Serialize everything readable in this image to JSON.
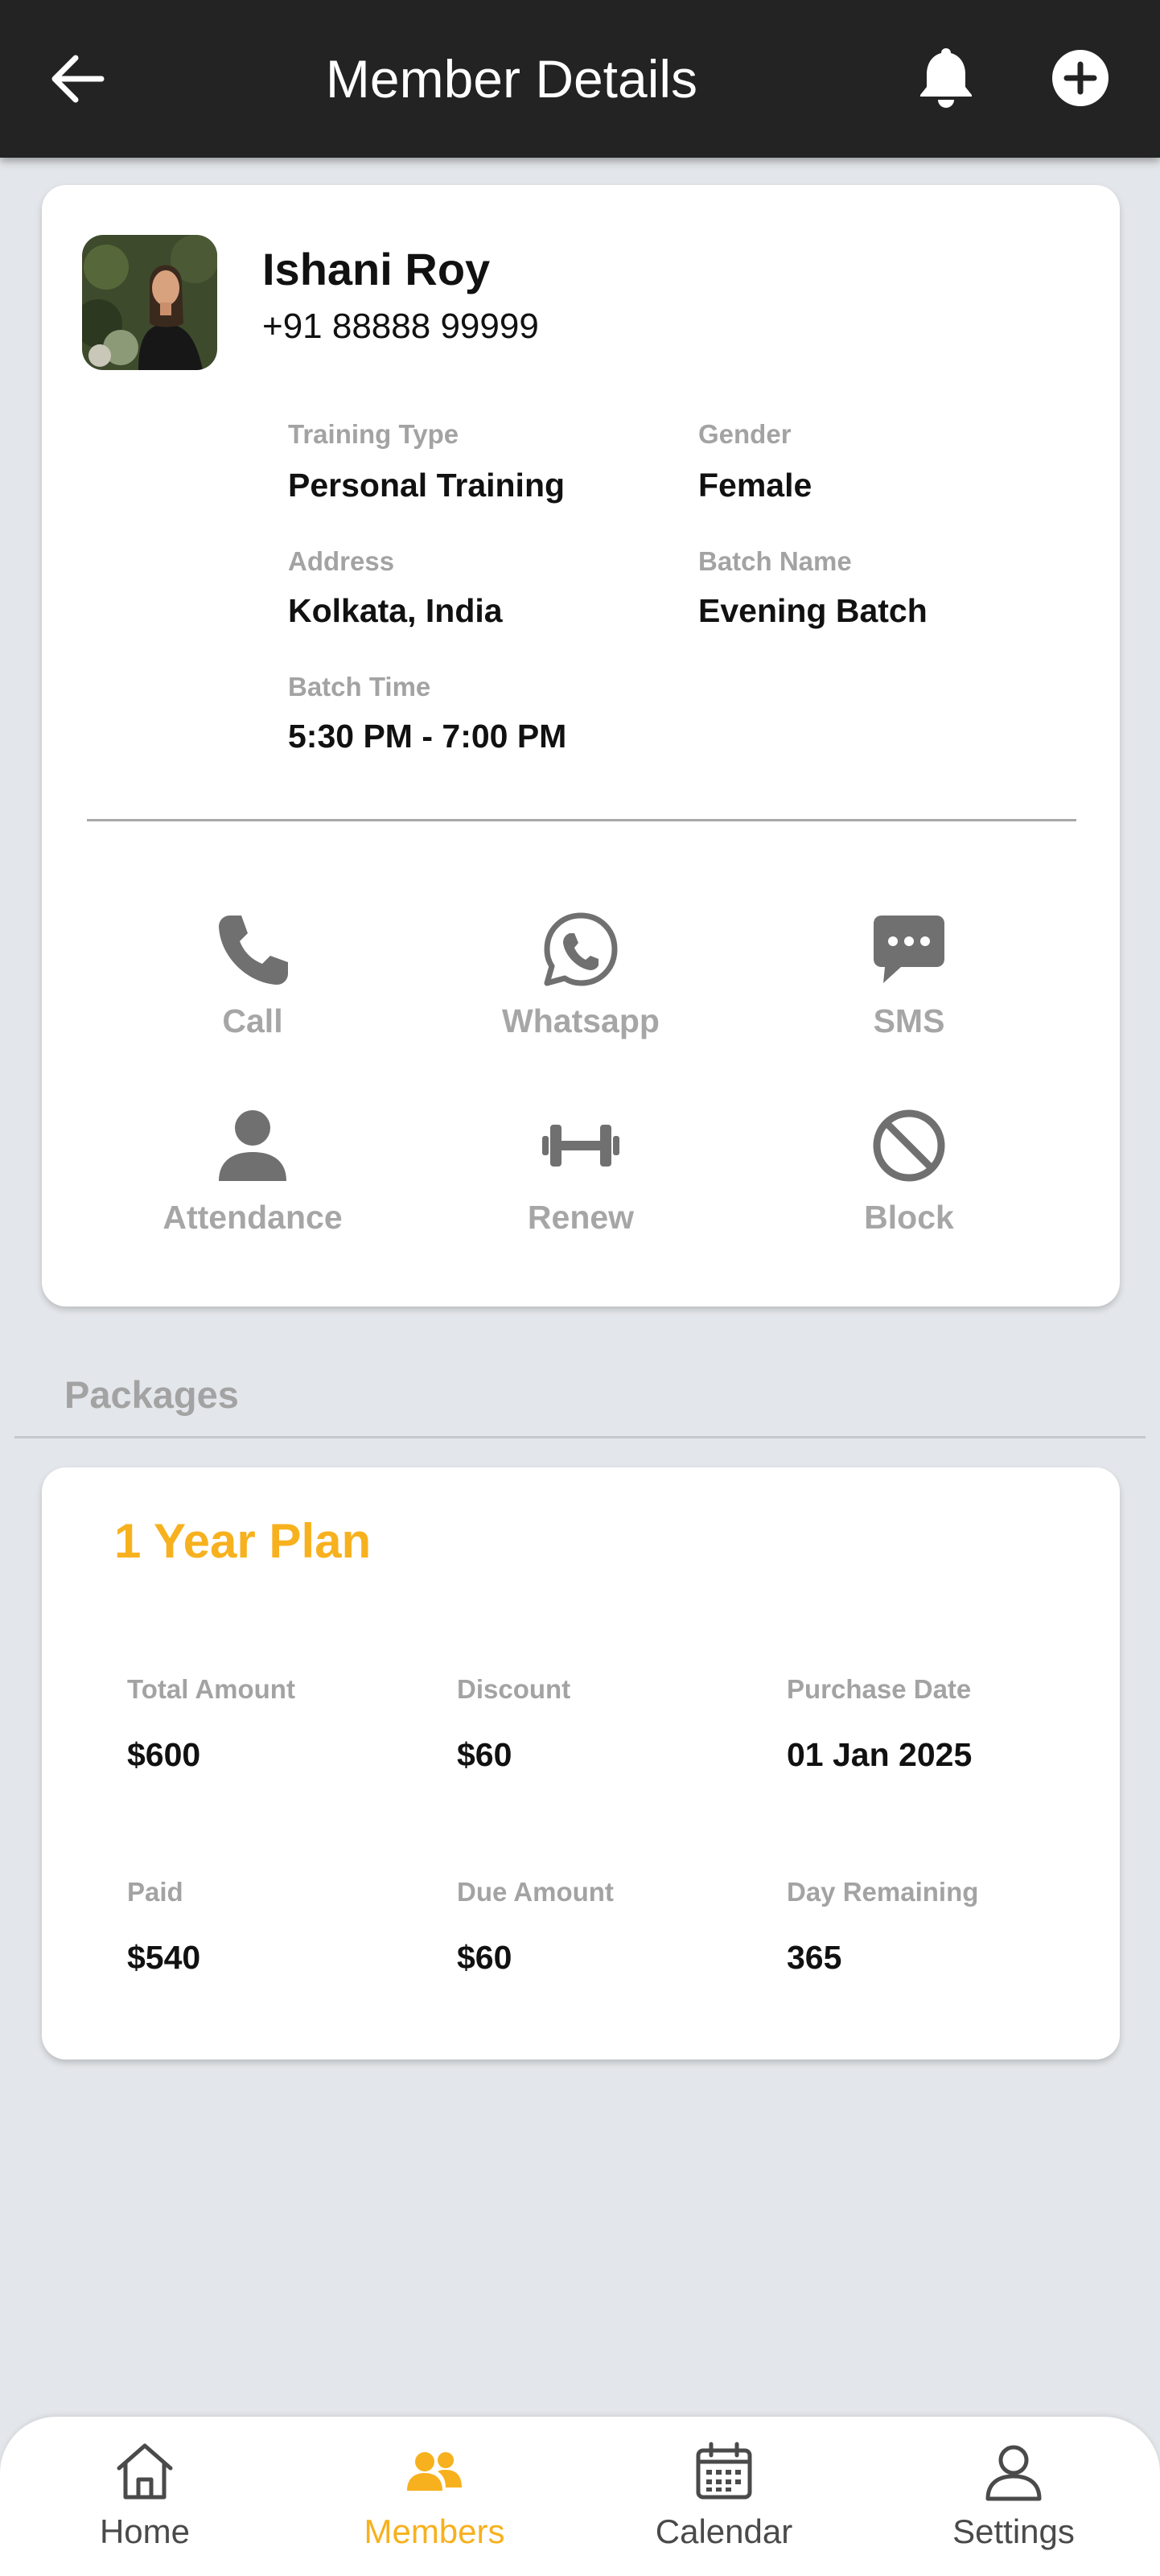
{
  "header": {
    "title": "Member Details",
    "back_icon": "arrow-left-icon",
    "bell_icon": "bell-icon",
    "add_icon": "plus-circle-icon"
  },
  "member": {
    "name": "Ishani Roy",
    "phone": "+91 88888 99999",
    "avatar": "member-photo",
    "details": {
      "training_type_label": "Training Type",
      "training_type": "Personal Training",
      "gender_label": "Gender",
      "gender": "Female",
      "address_label": "Address",
      "address": "Kolkata, India",
      "batch_name_label": "Batch Name",
      "batch_name": "Evening Batch",
      "batch_time_label": "Batch Time",
      "batch_time": "5:30 PM - 7:00 PM"
    },
    "actions": {
      "call": "Call",
      "whatsapp": "Whatsapp",
      "sms": "SMS",
      "attendance": "Attendance",
      "renew": "Renew",
      "block": "Block"
    }
  },
  "packages": {
    "section_title": "Packages",
    "items": [
      {
        "plan_name": "1 Year Plan",
        "total_amount_label": "Total Amount",
        "total_amount": "$600",
        "discount_label": "Discount",
        "discount": "$60",
        "purchase_date_label": "Purchase Date",
        "purchase_date": "01 Jan 2025",
        "paid_label": "Paid",
        "paid": "$540",
        "due_amount_label": "Due Amount",
        "due_amount": "$60",
        "day_remaining_label": "Day Remaining",
        "day_remaining": "365"
      }
    ]
  },
  "bottom_nav": {
    "items": [
      {
        "label": "Home",
        "icon": "home-icon"
      },
      {
        "label": "Members",
        "icon": "members-icon",
        "active": true
      },
      {
        "label": "Calendar",
        "icon": "calendar-icon"
      },
      {
        "label": "Settings",
        "icon": "settings-person-icon"
      }
    ]
  },
  "colors": {
    "accent": "#f7b11e",
    "header_bg": "#232323",
    "page_bg": "#e3e6ea",
    "icon_grey": "#6f6f6f",
    "label_grey": "#a3a3a3"
  }
}
